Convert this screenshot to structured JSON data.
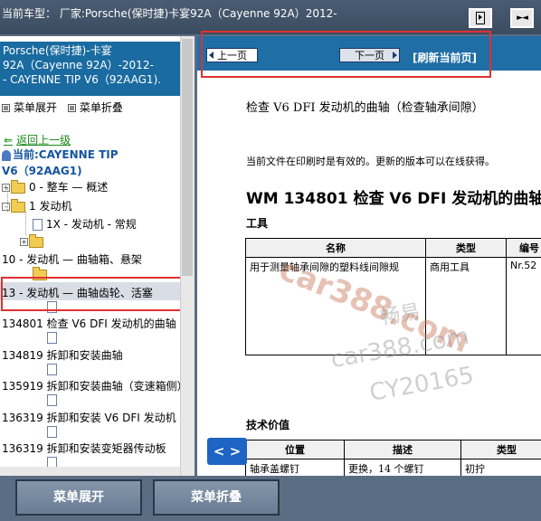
{
  "window": {
    "title": "当前车型：  厂家:Porsche(保时捷)卡宴92A（Cayenne 92A）2012-"
  },
  "car_info": {
    "lines": [
      "Porsche(保时捷)-卡宴",
      "92A（Cayenne 92A）-2012-",
      "- CAYENNE TIP V6（92AAG1)."
    ]
  },
  "menu": {
    "expand": "菜单展开",
    "collapse": "菜单折叠"
  },
  "nav": {
    "back": "返回上一级",
    "current_line1": "当前:CAYENNE TIP",
    "current_line2": "V6（92AAG1)"
  },
  "tree": [
    {
      "label": "0 - 整车 — 概述"
    },
    {
      "label": "1 发动机"
    },
    {
      "label": "1X - 发动机 - 常规"
    },
    {
      "label": ""
    },
    {
      "label": "10 - 发动机 — 曲轴箱、悬架"
    },
    {
      "label": ""
    },
    {
      "label": "13 - 发动机 — 曲轴齿轮、活塞"
    },
    {
      "label": ""
    },
    {
      "label": "134801 检查 V6 DFI 发动机的曲轴"
    },
    {
      "label": ""
    },
    {
      "label": "134819 拆卸和安装曲轴"
    },
    {
      "label": ""
    },
    {
      "label": "135919 拆卸和安装曲轴（变速箱侧）"
    },
    {
      "label": ""
    },
    {
      "label": "136319 拆卸和安装 V6 DFI 发动机"
    },
    {
      "label": ""
    },
    {
      "label": "136319 拆卸和安装变矩器传动板"
    },
    {
      "label": ""
    }
  ],
  "page_nav": {
    "prev": "上一页",
    "next": "下一页",
    "refresh": "[刷新当前页]"
  },
  "document": {
    "subtitle": "检查  V6 DFI 发动机的曲轴（检查轴承间隙）",
    "notice": "当前文件在印刷时是有效的。更新的版本可以在线获得。",
    "heading": "WM 134801 检查  V6 DFI 发动机的曲轴",
    "tools_label": "工具",
    "tools_table": {
      "headers": [
        "名称",
        "类型",
        "编号"
      ],
      "rows": [
        [
          "用于测量轴承间隙的塑料线间隙规",
          "商用工具",
          "Nr.52"
        ]
      ]
    },
    "tech_label": "技术价值",
    "tech_table": {
      "headers": [
        "位置",
        "描述",
        "类型"
      ],
      "rows": [
        [
          "轴承盖螺钉",
          "更换，14 个螺钉",
          "初拧"
        ]
      ]
    }
  },
  "arrow_button": "< >",
  "bottom": {
    "expand": "菜单展开",
    "collapse": "菜单折叠"
  },
  "watermark": {
    "line1": "car388.com",
    "line2": "畅易",
    "line3": "car388.com",
    "line4": "CY20165"
  }
}
